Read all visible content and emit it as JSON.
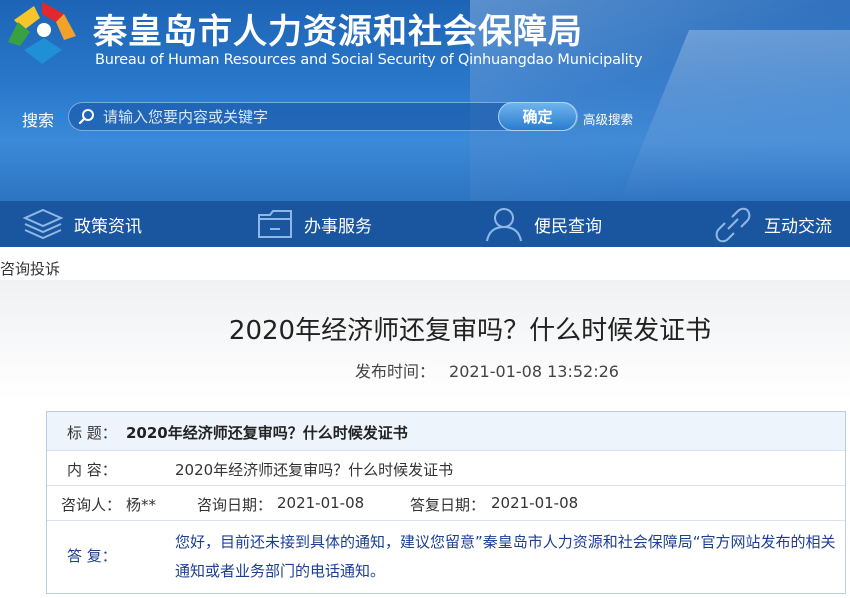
{
  "header": {
    "title": "秦皇岛市人力资源和社会保障局",
    "subtitle": "Bureau of Human Resources and Social Security of Qinhuangdao Municipality"
  },
  "search": {
    "label": "搜索",
    "placeholder": "请输入您要内容或关键字",
    "button": "确定",
    "advanced": "高级搜索"
  },
  "nav": {
    "items": [
      {
        "label": "政策资讯",
        "icon": "layers-icon"
      },
      {
        "label": "办事服务",
        "icon": "folder-icon"
      },
      {
        "label": "便民查询",
        "icon": "user-icon"
      },
      {
        "label": "互动交流",
        "icon": "link-icon"
      }
    ]
  },
  "breadcrumb": "咨询投诉",
  "article": {
    "title": "2020年经济师还复审吗？什么时候发证书",
    "publish_label": "发布时间：",
    "publish_time": "2021-01-08 13:52:26"
  },
  "detail": {
    "title_label": "标  题：",
    "title_value": "2020年经济师还复审吗？什么时候发证书",
    "content_label": "内  容：",
    "content_value": "2020年经济师还复审吗？什么时候发证书",
    "asker_label": "咨询人：",
    "asker_value": "杨**",
    "ask_date_label": "咨询日期：",
    "ask_date_value": "2021-01-08",
    "reply_date_label": "答复日期：",
    "reply_date_value": "2021-01-08",
    "reply_label": "答  复：",
    "reply_value": "您好，目前还未接到具体的通知，建议您留意”秦皇岛市人力资源和社会保障局“官方网站发布的相关通知或者业务部门的电话通知。"
  },
  "colors": {
    "banner": "#2a79cc",
    "nav": "#1a56a0",
    "reply_text": "#1c3f94"
  }
}
